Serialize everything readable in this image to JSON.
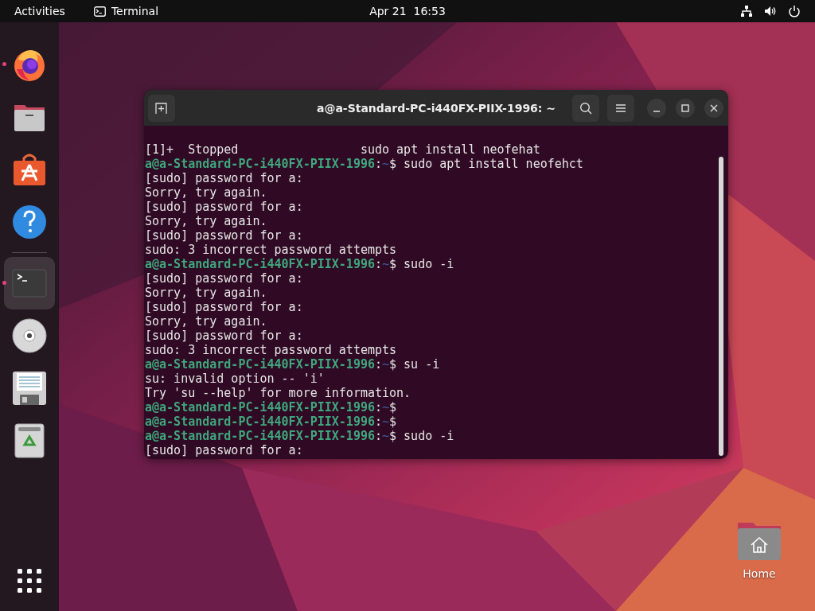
{
  "top_bar": {
    "activities": "Activities",
    "app_name": "Terminal",
    "clock": "Apr 21  16:53"
  },
  "dock": {
    "items": [
      {
        "kind": "firefox",
        "running": true,
        "selected": false
      },
      {
        "kind": "files",
        "running": false,
        "selected": false
      },
      {
        "kind": "software",
        "running": false,
        "selected": false
      },
      {
        "kind": "help",
        "running": false,
        "selected": false
      },
      {
        "kind": "separator"
      },
      {
        "kind": "terminal",
        "running": true,
        "selected": true
      },
      {
        "kind": "disc",
        "running": false,
        "selected": false
      },
      {
        "kind": "floppy",
        "running": false,
        "selected": false
      },
      {
        "kind": "trash",
        "running": false,
        "selected": false
      }
    ]
  },
  "terminal": {
    "title": "a@a-Standard-PC-i440FX-PIIX-1996: ~",
    "prompt_separator": ":",
    "prompt_sign": "$",
    "lines": [
      {
        "kind": "output",
        "text": "[1]+  Stopped                 sudo apt install neofehat"
      },
      {
        "kind": "prompt",
        "host": "a@a-Standard-PC-i440FX-PIIX-1996",
        "path": "~",
        "command": "sudo apt install neofehct"
      },
      {
        "kind": "output",
        "text": "[sudo] password for a:"
      },
      {
        "kind": "output",
        "text": "Sorry, try again."
      },
      {
        "kind": "output",
        "text": "[sudo] password for a:"
      },
      {
        "kind": "output",
        "text": "Sorry, try again."
      },
      {
        "kind": "output",
        "text": "[sudo] password for a:"
      },
      {
        "kind": "output",
        "text": "sudo: 3 incorrect password attempts"
      },
      {
        "kind": "prompt",
        "host": "a@a-Standard-PC-i440FX-PIIX-1996",
        "path": "~",
        "command": "sudo -i"
      },
      {
        "kind": "output",
        "text": "[sudo] password for a:"
      },
      {
        "kind": "output",
        "text": "Sorry, try again."
      },
      {
        "kind": "output",
        "text": "[sudo] password for a:"
      },
      {
        "kind": "output",
        "text": "Sorry, try again."
      },
      {
        "kind": "output",
        "text": "[sudo] password for a:"
      },
      {
        "kind": "output",
        "text": "sudo: 3 incorrect password attempts"
      },
      {
        "kind": "prompt",
        "host": "a@a-Standard-PC-i440FX-PIIX-1996",
        "path": "~",
        "command": "su -i"
      },
      {
        "kind": "output",
        "text": "su: invalid option -- 'i'"
      },
      {
        "kind": "output",
        "text": "Try 'su --help' for more information."
      },
      {
        "kind": "prompt",
        "host": "a@a-Standard-PC-i440FX-PIIX-1996",
        "path": "~"
      },
      {
        "kind": "prompt",
        "host": "a@a-Standard-PC-i440FX-PIIX-1996",
        "path": "~"
      },
      {
        "kind": "prompt",
        "host": "a@a-Standard-PC-i440FX-PIIX-1996",
        "path": "~",
        "command": "sudo -i"
      },
      {
        "kind": "output",
        "text": "[sudo] password for a:"
      }
    ]
  },
  "desktop_icons": [
    {
      "label": "Home"
    }
  ]
}
